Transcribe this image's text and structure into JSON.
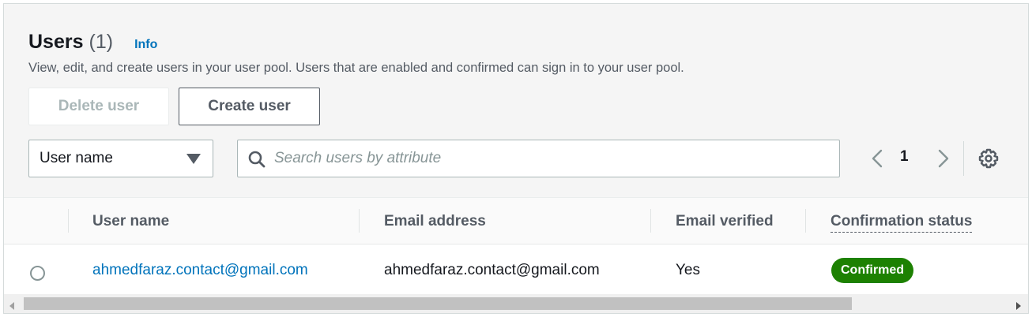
{
  "header": {
    "title": "Users",
    "count": "(1)",
    "info_link": "Info",
    "description": "View, edit, and create users in your user pool. Users that are enabled and confirmed can sign in to your user pool."
  },
  "actions": {
    "delete_label": "Delete user",
    "create_label": "Create user"
  },
  "filter": {
    "property_selected": "User name",
    "search_placeholder": "Search users by attribute",
    "search_value": ""
  },
  "pagination": {
    "current_page": "1"
  },
  "table": {
    "columns": [
      "User name",
      "Email address",
      "Email verified",
      "Confirmation status"
    ],
    "rows": [
      {
        "user_name": "ahmedfaraz.contact@gmail.com",
        "email": "ahmedfaraz.contact@gmail.com",
        "email_verified": "Yes",
        "status": "Confirmed",
        "selected": false
      }
    ]
  },
  "icons": {
    "caret": "caret-down-icon",
    "search": "search-icon",
    "prev": "chevron-left-icon",
    "next": "chevron-right-icon",
    "settings": "gear-icon"
  },
  "colors": {
    "link": "#0073bb",
    "status_confirmed": "#1d8102",
    "text_secondary": "#545b64"
  }
}
